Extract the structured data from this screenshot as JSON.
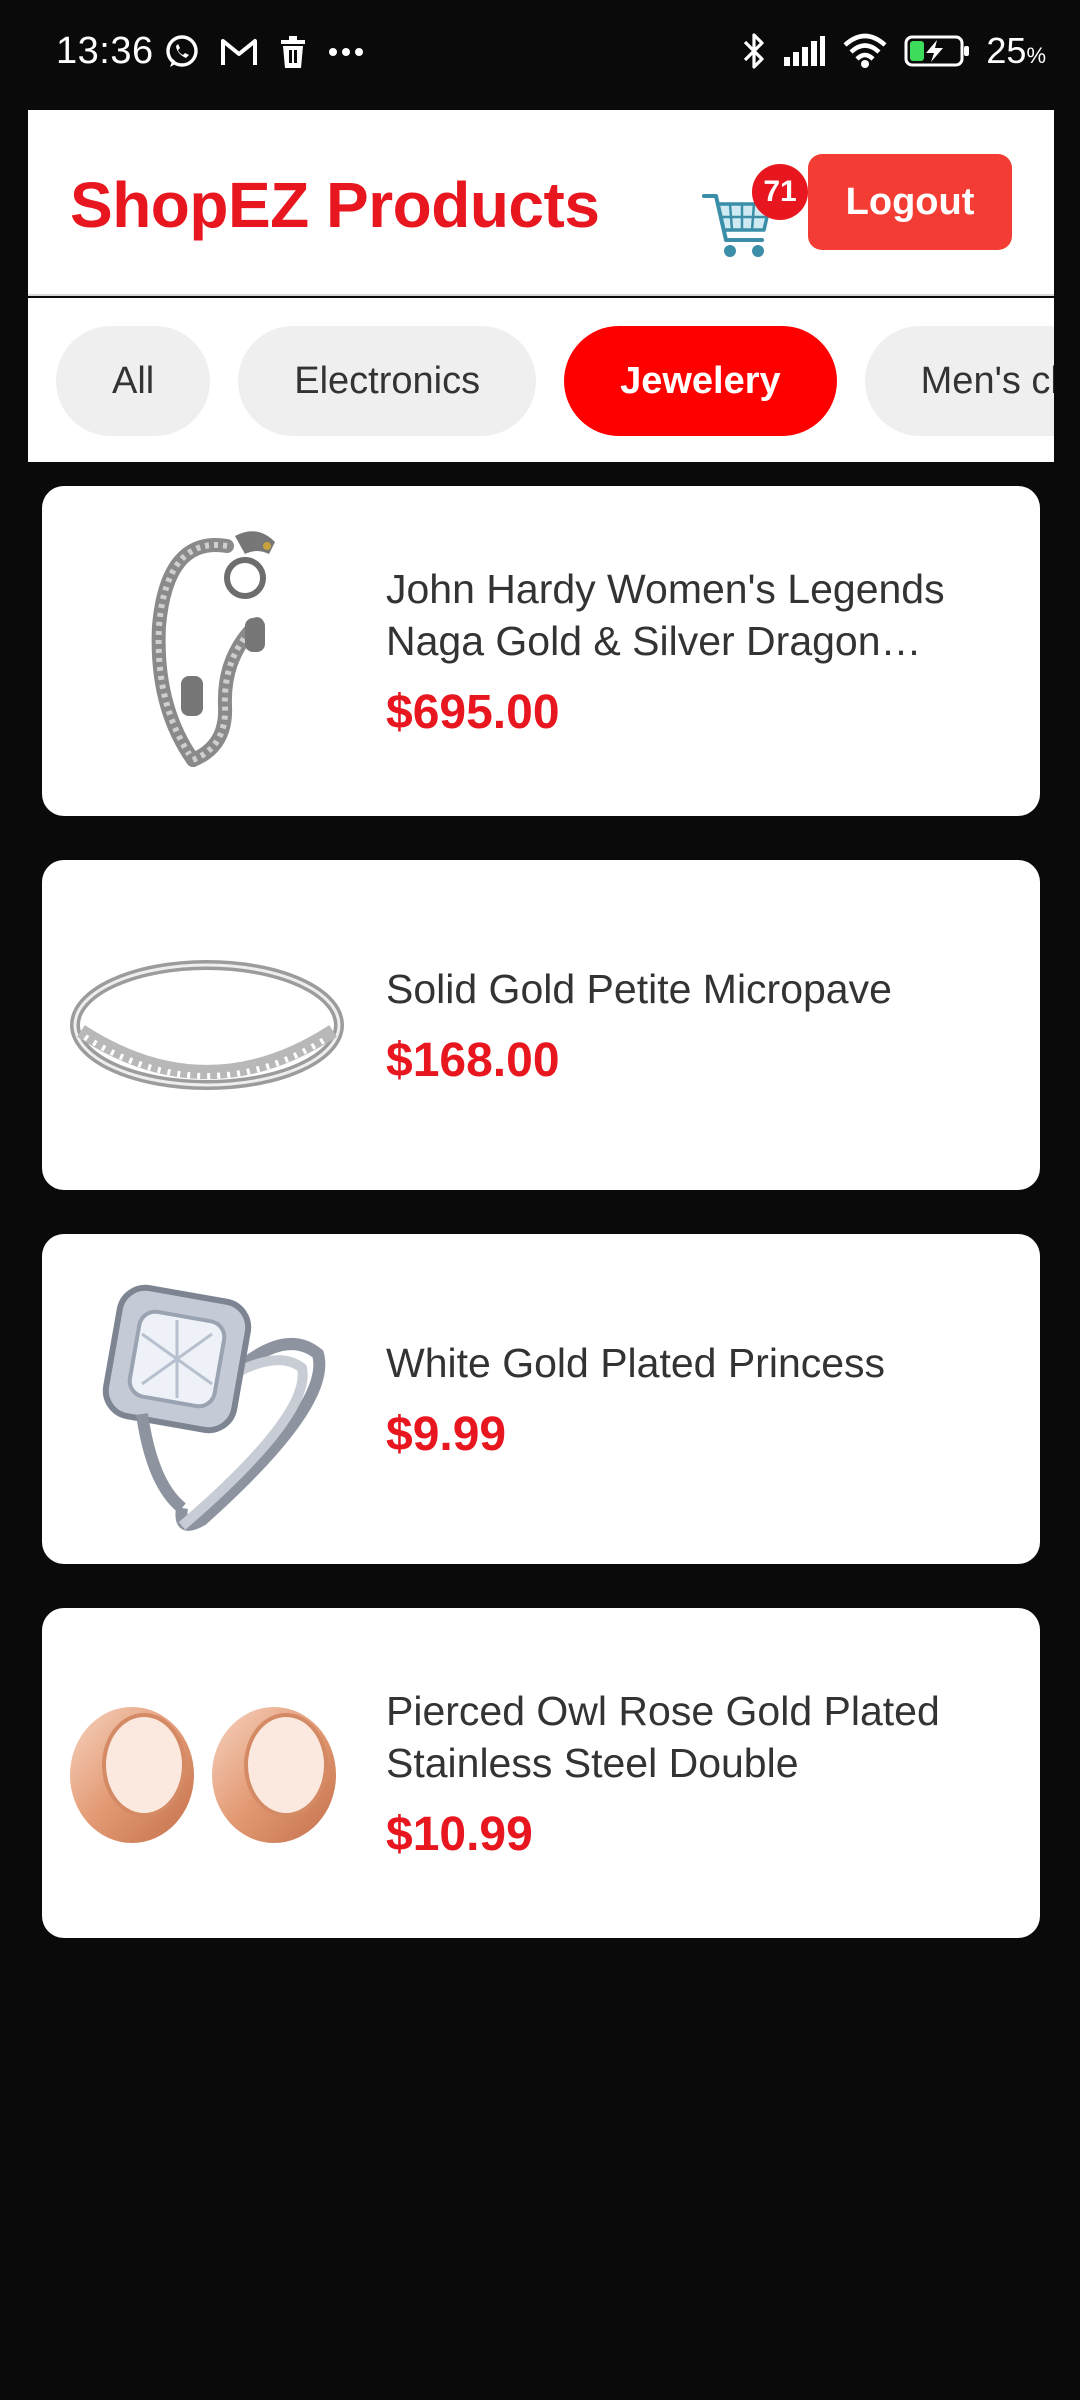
{
  "status_bar": {
    "time": "13:36",
    "battery_percent": "25",
    "battery_unit": "%",
    "left_icons": [
      "whatsapp-icon",
      "gmail-icon",
      "trash-icon",
      "more-dots-icon"
    ],
    "right_icons": [
      "bluetooth-icon",
      "signal-icon",
      "wifi-icon",
      "battery-charging-icon"
    ]
  },
  "header": {
    "title": "ShopEZ Products",
    "cart_count": "71",
    "logout_label": "Logout"
  },
  "colors": {
    "brand_red": "#e8161e",
    "logout_red": "#f33d34",
    "chip_active": "#ff0000",
    "chip_inactive": "#efefef"
  },
  "categories": {
    "selected": "Jewelery",
    "items": [
      {
        "label": "All"
      },
      {
        "label": "Electronics"
      },
      {
        "label": "Jewelery"
      },
      {
        "label": "Men's clothing"
      }
    ]
  },
  "products": [
    {
      "title": "John Hardy Women's Legends Naga Gold & Silver Dragon Station Chain Bracelet",
      "price": "$695.00",
      "image": "bracelet-image"
    },
    {
      "title": "Solid Gold Petite Micropave",
      "price": "$168.00",
      "image": "ring-band-image"
    },
    {
      "title": "White Gold Plated Princess",
      "price": "$9.99",
      "image": "princess-ring-image"
    },
    {
      "title": "Pierced Owl Rose Gold Plated Stainless Steel Double",
      "price": "$10.99",
      "image": "ear-tunnels-image"
    }
  ]
}
